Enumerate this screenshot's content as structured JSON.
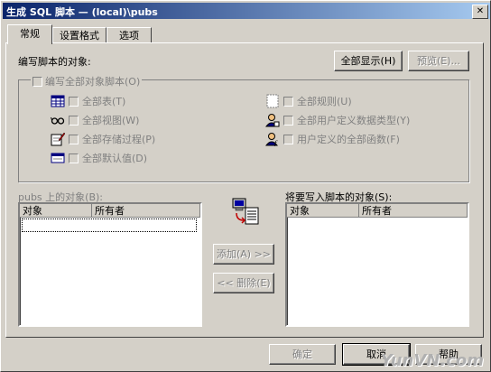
{
  "window": {
    "title": "生成 SQL 脚本 — (local)\\pubs"
  },
  "tabs": [
    {
      "label": "常规",
      "active": true
    },
    {
      "label": "设置格式",
      "active": false
    },
    {
      "label": "选项",
      "active": false
    }
  ],
  "general": {
    "objects_label": "编写脚本的对象:",
    "show_all_label": "全部显示(H)",
    "preview_label": "预览(E)...",
    "script_all_label": "编写全部对象脚本(O)",
    "options": {
      "all_tables": "全部表(T)",
      "all_views": "全部视图(W)",
      "all_procs": "全部存储过程(P)",
      "all_defaults": "全部默认值(D)",
      "all_rules": "全部规则(U)",
      "all_udt": "全部用户定义数据类型(Y)",
      "all_udf": "用户定义的全部函数(F)"
    },
    "source_list": {
      "label": "pubs 上的对象(B):",
      "col_object": "对象",
      "col_owner": "所有者"
    },
    "target_list": {
      "label": "将要写入脚本的对象(S):",
      "col_object": "对象",
      "col_owner": "所有者"
    },
    "add_label": "添加(A) >>",
    "remove_label": "<< 删除(E)"
  },
  "footer": {
    "ok_label": "确定",
    "cancel_label": "取消",
    "help_label": "帮助"
  },
  "watermark": "YunVN.com"
}
